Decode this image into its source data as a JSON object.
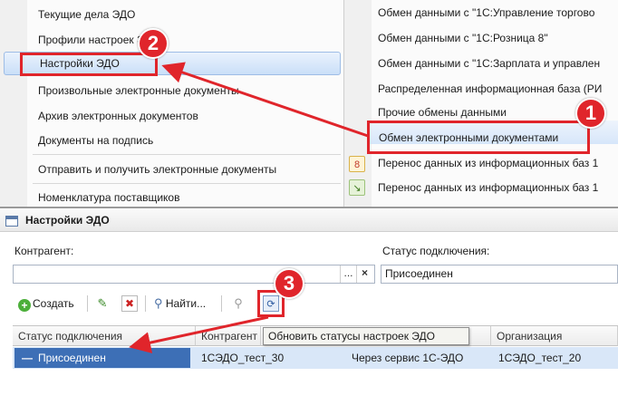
{
  "left_menu": {
    "items": [
      "Текущие дела ЭДО",
      "Профили настроек ЭДО",
      "Настройки ЭДО",
      "Произвольные электронные документы",
      "Архив электронных документов",
      "Документы на подпись",
      "Отправить и получить электронные документы",
      "Номенклатура поставщиков"
    ],
    "highlighted": "Настройки ЭДО"
  },
  "right_menu": {
    "items": [
      "Обмен данными с \"1С:Управление торгово",
      "Обмен данными с \"1С:Розница 8\"",
      "Обмен данными с \"1С:Зарплата и управлен",
      "Распределенная информационная база (РИ",
      "Прочие обмены данными",
      "Обмен электронными документами",
      "Перенос данных из информационных баз 1",
      "Перенос данных из информационных баз 1"
    ],
    "highlighted": "Обмен электронными документами"
  },
  "window": {
    "title": "Настройки ЭДО",
    "counterparty_label": "Контрагент:",
    "counterparty_value": "",
    "counterparty_select_btn": "...",
    "counterparty_clear_btn": "×",
    "status_label": "Статус подключения:",
    "status_value": "Присоединен"
  },
  "toolbar": {
    "create_label": "Создать",
    "find_label": "Найти..."
  },
  "table": {
    "columns": [
      "Статус подключения",
      "Контрагент",
      "",
      "Организация"
    ],
    "rows": [
      {
        "status": "Присоединен",
        "counterparty": "1СЭДО_тест_30",
        "method": "Через сервис 1С-ЭДО",
        "organization": "1СЭДО_тест_20"
      }
    ],
    "tooltip": "Обновить статусы настроек ЭДО"
  },
  "annotations": {
    "badges": [
      "1",
      "2",
      "3"
    ],
    "color": "#e0252b"
  }
}
